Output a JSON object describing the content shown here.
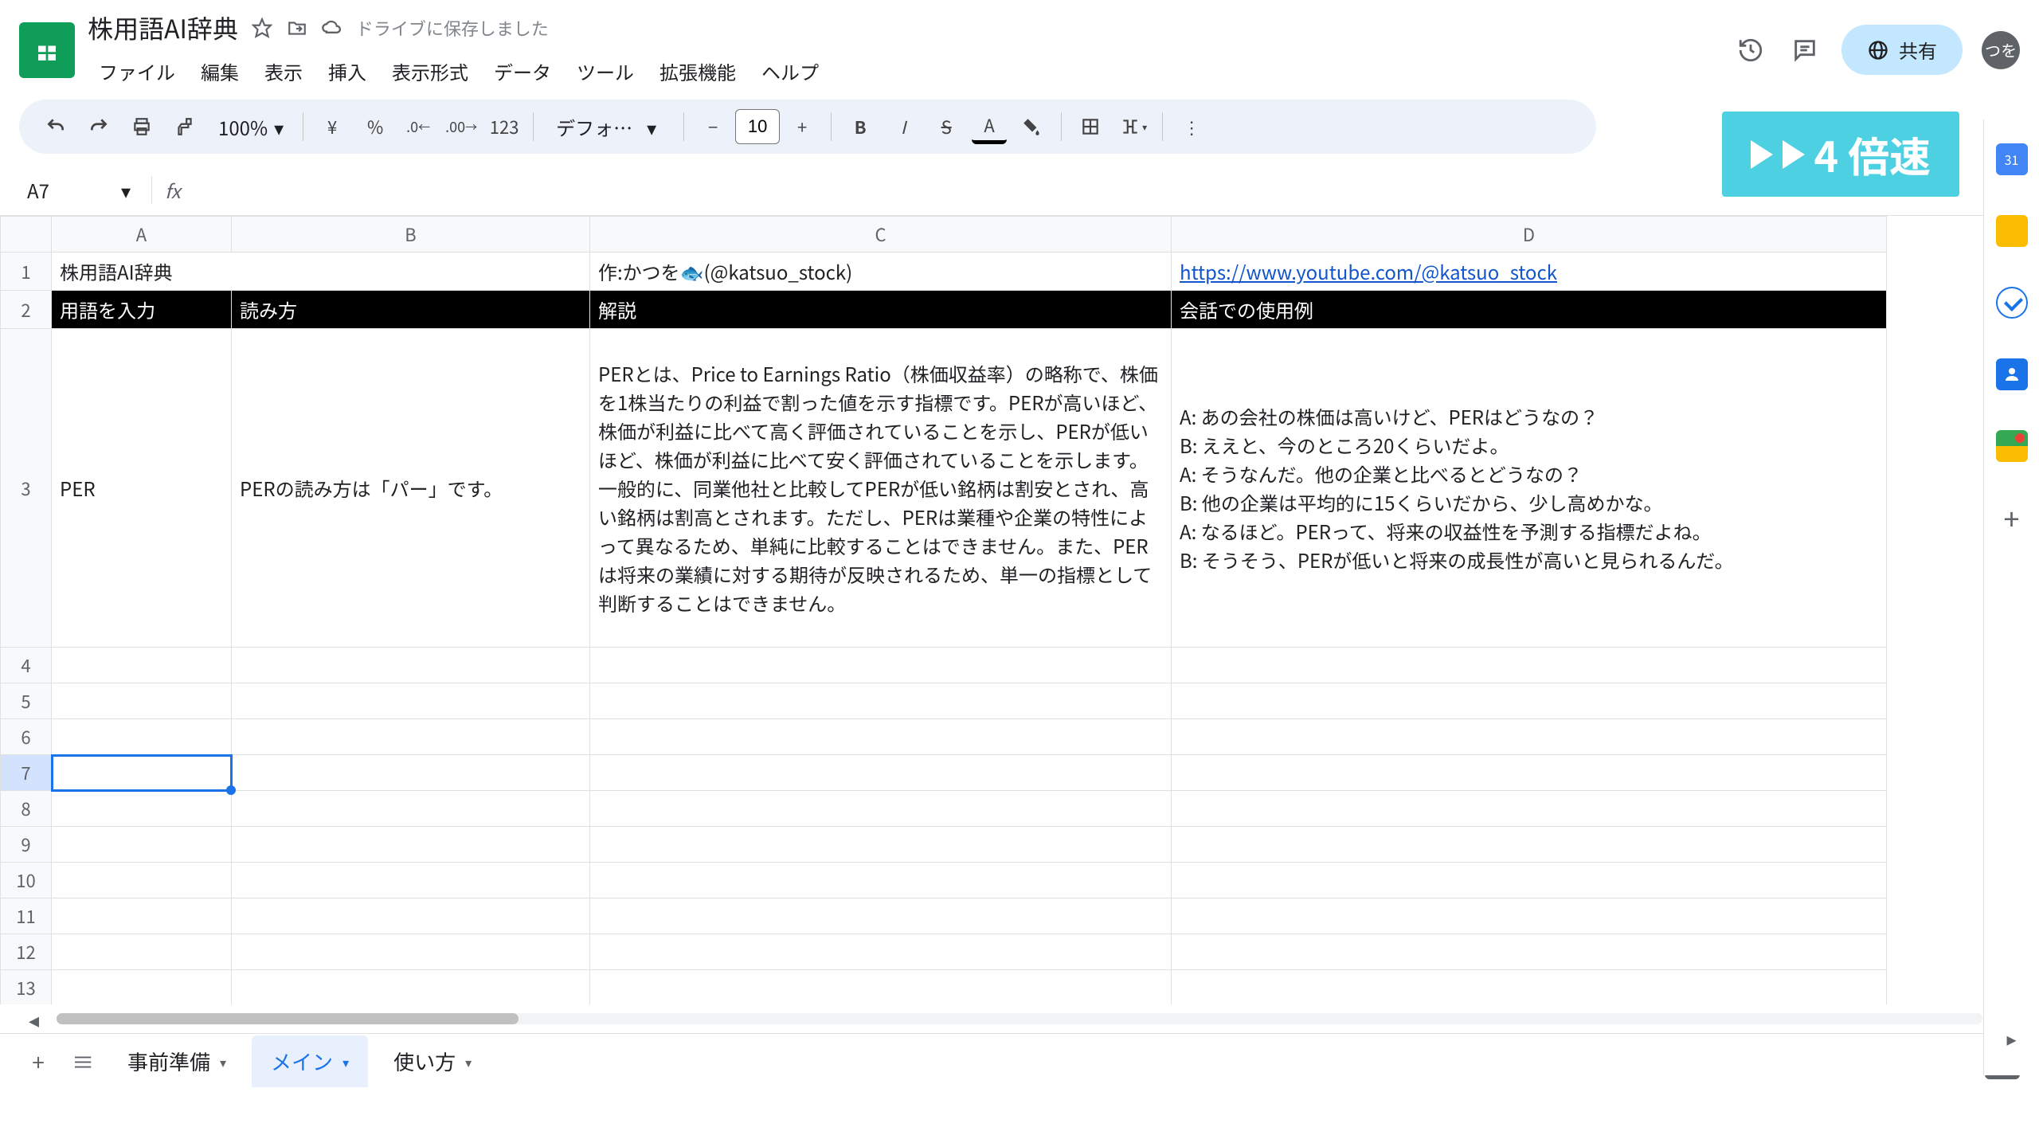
{
  "doc": {
    "title": "株用語AI辞典",
    "save_status": "ドライブに保存しました"
  },
  "menu": {
    "file": "ファイル",
    "edit": "編集",
    "view": "表示",
    "insert": "挿入",
    "format": "表示形式",
    "data": "データ",
    "tools": "ツール",
    "extensions": "拡張機能",
    "help": "ヘルプ"
  },
  "header": {
    "share": "共有",
    "avatar": "つを"
  },
  "toolbar": {
    "zoom": "100%",
    "currency": "¥",
    "percent": "%",
    "dec_dec": ".0",
    "inc_dec": ".00",
    "num123": "123",
    "font": "デフォ…",
    "font_size": "10",
    "bold": "B",
    "italic": "I",
    "strike": "S"
  },
  "overlay": {
    "speed": "4 倍速"
  },
  "namebox": {
    "cell": "A7",
    "fx": "fx"
  },
  "columns": {
    "A": "A",
    "B": "B",
    "C": "C",
    "D": "D"
  },
  "rows": [
    "1",
    "2",
    "3",
    "4",
    "5",
    "6",
    "7",
    "8",
    "9",
    "10",
    "11",
    "12",
    "13"
  ],
  "cells": {
    "A1": "株用語AI辞典",
    "C1": "作:かつを🐟(@katsuo_stock)",
    "D1": "https://www.youtube.com/@katsuo_stock",
    "A2": "用語を入力",
    "B2": "読み方",
    "C2": "解説",
    "D2": "会話での使用例",
    "A3": "PER",
    "B3": "PERの読み方は「パー」です。",
    "C3": "PERとは、Price to Earnings Ratio（株価収益率）の略称で、株価を1株当たりの利益で割った値を示す指標です。PERが高いほど、株価が利益に比べて高く評価されていることを示し、PERが低いほど、株価が利益に比べて安く評価されていることを示します。一般的に、同業他社と比較してPERが低い銘柄は割安とされ、高い銘柄は割高とされます。ただし、PERは業種や企業の特性によって異なるため、単純に比較することはできません。また、PERは将来の業績に対する期待が反映されるため、単一の指標として判断することはできません。",
    "D3": "A: あの会社の株価は高いけど、PERはどうなの？\nB: ええと、今のところ20くらいだよ。\nA: そうなんだ。他の企業と比べるとどうなの？\nB: 他の企業は平均的に15くらいだから、少し高めかな。\nA: なるほど。PERって、将来の収益性を予測する指標だよね。\nB: そうそう、PERが低いと将来の成長性が高いと見られるんだ。"
  },
  "tabs": {
    "t1": "事前準備",
    "t2": "メイン",
    "t3": "使い方"
  },
  "sidepanel": {
    "cal": "31"
  }
}
